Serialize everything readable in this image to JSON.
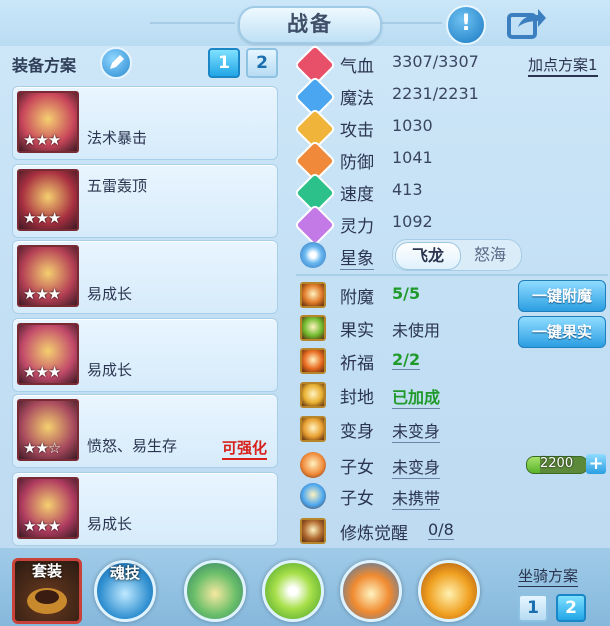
{
  "header": {
    "title": "战备"
  },
  "plan": {
    "label": "装备方案",
    "tabs": [
      "1",
      "2"
    ],
    "active_tab": 0
  },
  "equipment": [
    {
      "name": "法术暴击",
      "stars": "★★★",
      "tag": ""
    },
    {
      "name": "五雷轰顶",
      "stars": "★★★",
      "tag": ""
    },
    {
      "name": "易成长",
      "stars": "★★★",
      "tag": ""
    },
    {
      "name": "易成长",
      "stars": "★★★",
      "tag": ""
    },
    {
      "name": "愤怒、易生存",
      "stars": "★★☆",
      "tag": "可强化"
    },
    {
      "name": "易成长",
      "stars": "★★★",
      "tag": ""
    }
  ],
  "stats": [
    {
      "label": "气血",
      "value": "3307/3307",
      "color": "#e8506a"
    },
    {
      "label": "魔法",
      "value": "2231/2231",
      "color": "#4aa6f0"
    },
    {
      "label": "攻击",
      "value": "1030",
      "color": "#f0b43a"
    },
    {
      "label": "防御",
      "value": "1041",
      "color": "#f08a3a"
    },
    {
      "label": "速度",
      "value": "413",
      "color": "#2cc08a"
    },
    {
      "label": "灵力",
      "value": "1092",
      "color": "#c37ae6"
    }
  ],
  "add_point_plan": "加点方案1",
  "star_sign": {
    "label": "星象",
    "options": [
      "飞龙",
      "怒海"
    ],
    "active": 0
  },
  "systems": [
    {
      "label": "附魔",
      "value": "5/5",
      "style": "green"
    },
    {
      "label": "果实",
      "value": "未使用",
      "style": "plain"
    },
    {
      "label": "祈福",
      "value": "2/2",
      "style": "green-ul"
    },
    {
      "label": "封地",
      "value": "已加成",
      "style": "green-ul"
    },
    {
      "label": "变身",
      "value": "未变身",
      "style": "ul"
    },
    {
      "label": "子女",
      "value": "未变身",
      "style": "ul"
    },
    {
      "label": "子女",
      "value": "未携带",
      "style": "ul"
    },
    {
      "label": "修炼觉醒",
      "value": "0/8",
      "style": "ul"
    }
  ],
  "buttons": {
    "enchant": "一键附魔",
    "fruit": "一键果实"
  },
  "child_bar": {
    "value": "2200",
    "fraction": 0.22
  },
  "bottom": {
    "suit": "套装",
    "skill": "魂技",
    "mount_plan": "坐骑方案",
    "mount_tabs": [
      "1",
      "2"
    ],
    "mount_active": 1
  }
}
